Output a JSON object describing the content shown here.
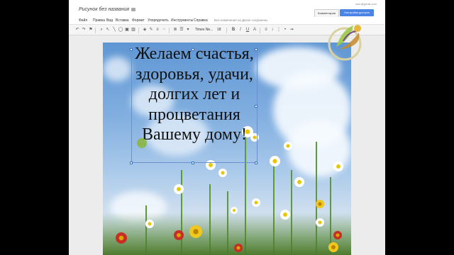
{
  "header": {
    "doc_title": "Рисунок без названия",
    "user_email": "user@gmail.com",
    "comments_label": "Комментарии",
    "share_label": "Настройки доступа"
  },
  "menu": {
    "items": [
      "Файл",
      "Правка",
      "Вид",
      "Вставка",
      "Формат",
      "Упорядочить",
      "Инструменты",
      "Справка"
    ],
    "saved_status": "Все изменения на Диске сохранены"
  },
  "toolbar": {
    "font_name": "Times Ne...",
    "font_size": "18",
    "bold": "B",
    "italic": "I",
    "underline": "U"
  },
  "canvas": {
    "greeting_lines": [
      "Желаем счастья,",
      "здоровья, удачи,",
      "долгих лет и",
      "процветания",
      "Вашему дому!"
    ]
  },
  "colors": {
    "share_button": "#4a84e6",
    "selection": "#6b8fd0",
    "sky": "#82afe0"
  }
}
